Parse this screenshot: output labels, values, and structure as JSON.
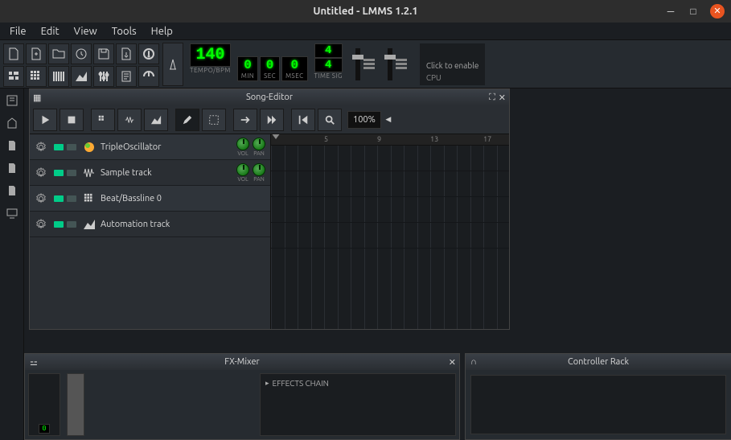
{
  "window": {
    "title": "Untitled - LMMS 1.2.1"
  },
  "menu": {
    "file": "File",
    "edit": "Edit",
    "view": "View",
    "tools": "Tools",
    "help": "Help"
  },
  "transport": {
    "tempo": "140",
    "tempo_label": "TEMPO/BPM",
    "min": "0",
    "min_label": "MIN",
    "sec": "0",
    "sec_label": "SEC",
    "msec": "0",
    "msec_label": "MSEC",
    "timesig_num": "4",
    "timesig_den": "4",
    "timesig_label": "TIME SIG",
    "cpu_hint": "Click to enable",
    "cpu_label": "CPU"
  },
  "song_editor": {
    "title": "Song-Editor",
    "zoom": "100%",
    "ruler": [
      "5",
      "9",
      "13",
      "17"
    ],
    "tracks": [
      {
        "name": "TripleOscillator",
        "vol_label": "VOL",
        "pan_label": "PAN",
        "has_knobs": true,
        "icon": "osc"
      },
      {
        "name": "Sample track",
        "vol_label": "VOL",
        "pan_label": "PAN",
        "has_knobs": true,
        "icon": "wave"
      },
      {
        "name": "Beat/Bassline 0",
        "has_knobs": false,
        "icon": "bb"
      },
      {
        "name": "Automation track",
        "has_knobs": false,
        "icon": "auto"
      }
    ]
  },
  "fx_mixer": {
    "title": "FX-Mixer",
    "master_index": "0",
    "effects_chain": "EFFECTS CHAIN"
  },
  "controller_rack": {
    "title": "Controller Rack"
  }
}
